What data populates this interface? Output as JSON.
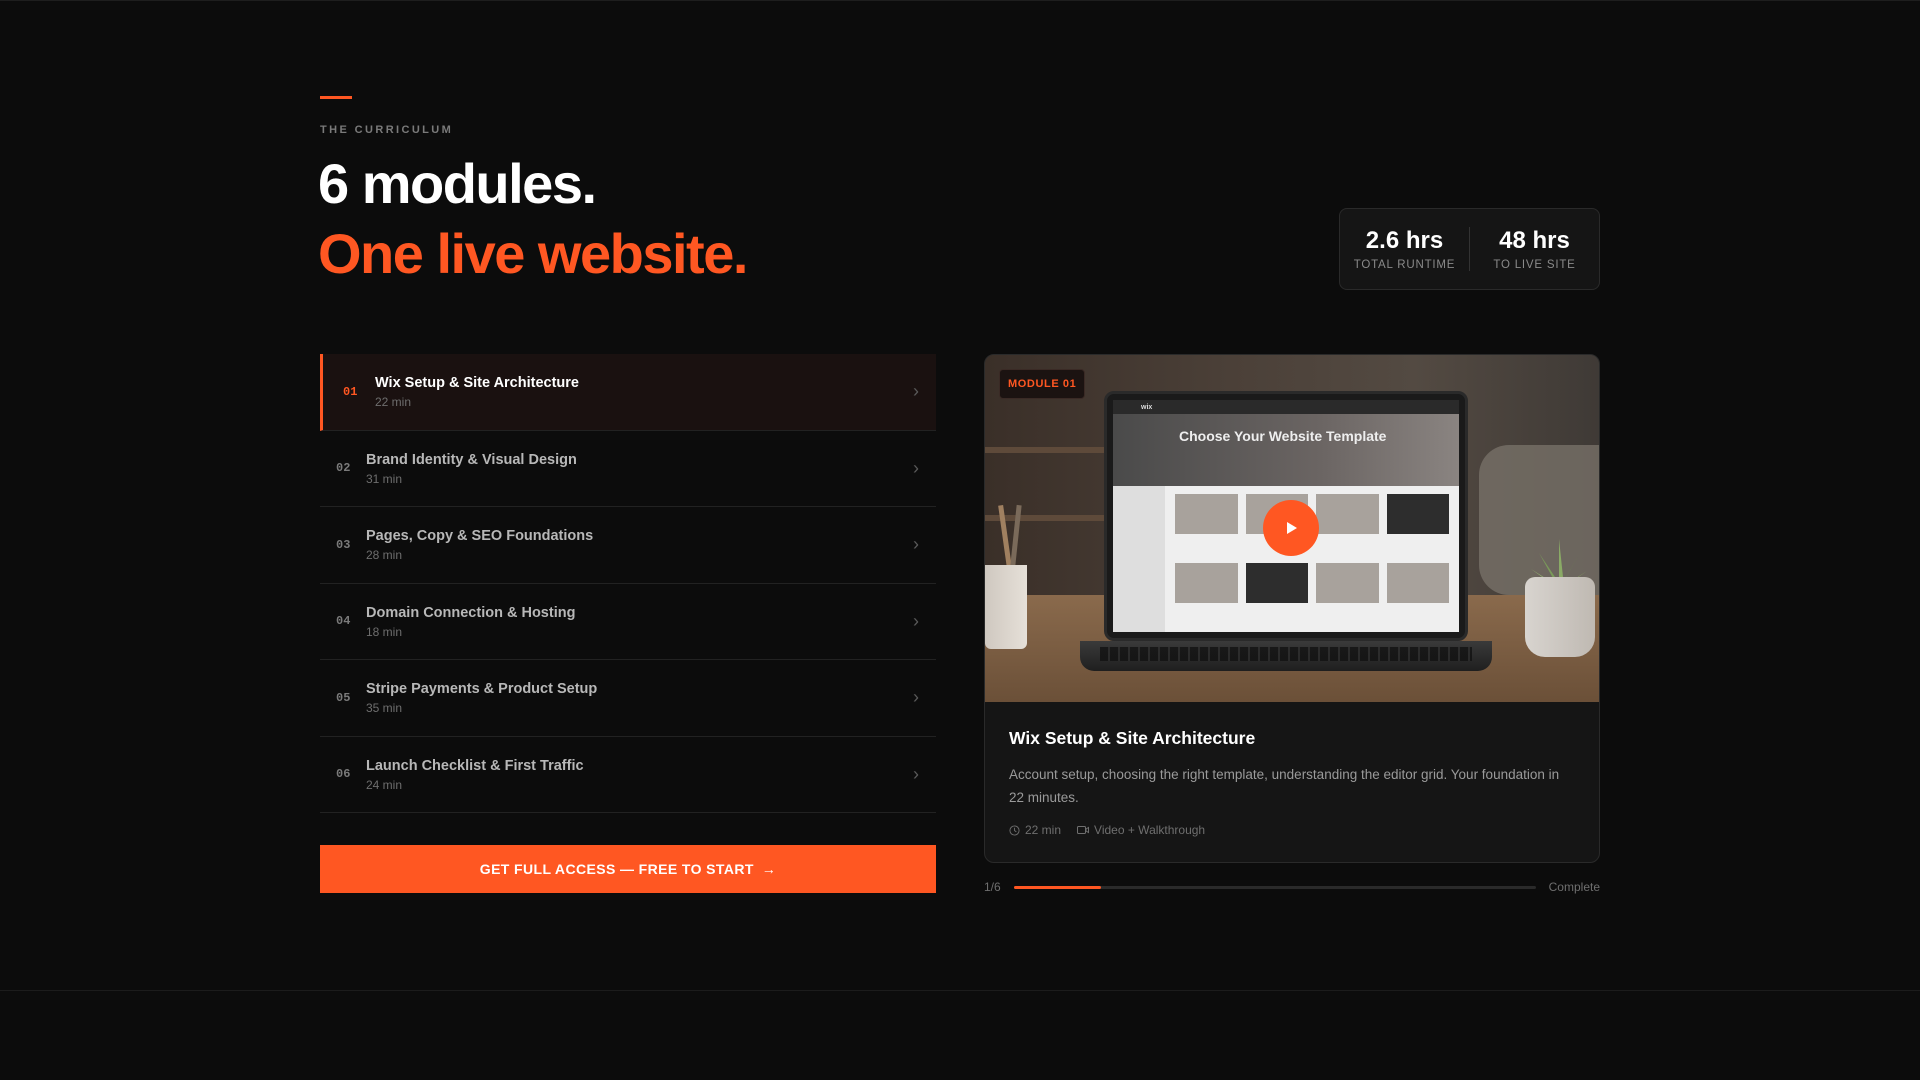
{
  "section": {
    "eyebrow": "THE CURRICULUM",
    "title_line1": "6 modules.",
    "title_line2": "One live website."
  },
  "stats": [
    {
      "value": "2.6 hrs",
      "label": "TOTAL RUNTIME"
    },
    {
      "value": "48 hrs",
      "label": "TO LIVE SITE"
    }
  ],
  "modules": [
    {
      "num": "01",
      "title": "Wix Setup & Site Architecture",
      "duration": "22 min",
      "active": true
    },
    {
      "num": "02",
      "title": "Brand Identity & Visual Design",
      "duration": "31 min",
      "active": false
    },
    {
      "num": "03",
      "title": "Pages, Copy & SEO Foundations",
      "duration": "28 min",
      "active": false
    },
    {
      "num": "04",
      "title": "Domain Connection & Hosting",
      "duration": "18 min",
      "active": false
    },
    {
      "num": "05",
      "title": "Stripe Payments & Product Setup",
      "duration": "35 min",
      "active": false
    },
    {
      "num": "06",
      "title": "Launch Checklist & First Traffic",
      "duration": "24 min",
      "active": false
    }
  ],
  "cta": {
    "label": "GET FULL ACCESS — FREE TO START",
    "icon": "arrow-right-icon"
  },
  "preview": {
    "badge": "MODULE 01",
    "screen_heading": "Choose Your Website Template",
    "screen_logo": "wix",
    "title": "Wix Setup & Site Architecture",
    "description": "Account setup, choosing the right template, understanding the editor grid. Your foundation in 22 minutes.",
    "meta_duration": "22 min",
    "meta_format": "Video + Walkthrough"
  },
  "progress": {
    "count": "1/6",
    "label": "Complete",
    "value": 0.1667
  },
  "colors": {
    "accent": "#ff5722",
    "background": "#0c0c0c",
    "card": "#151515"
  }
}
